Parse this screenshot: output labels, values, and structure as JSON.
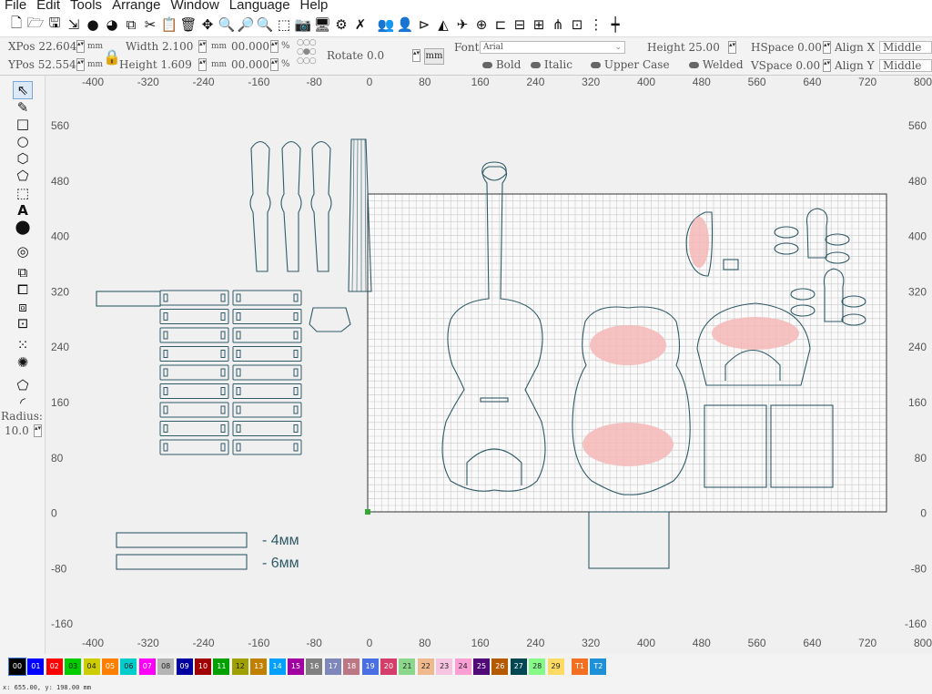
{
  "menu": [
    "File",
    "Edit",
    "Tools",
    "Arrange",
    "Window",
    "Language",
    "Help"
  ],
  "toolbar_icons": [
    "new-file-icon",
    "open-folder-icon",
    "save-icon",
    "export-icon",
    "undo-icon",
    "redo-icon",
    "copy-icon",
    "cut-icon",
    "paste-icon",
    "delete-icon",
    "move-icon",
    "zoom-in-icon",
    "zoom-out-icon",
    "zoom-fit-icon",
    "camera-icon",
    "monitor-icon",
    "settings-tools-icon",
    "users-icon",
    "user-icon",
    "align-icon",
    "mirror-icon",
    "send-icon",
    "target-icon",
    "arrange-icon",
    "distribute-icon",
    "group-icon",
    "ungroup-icon",
    "grid-icon"
  ],
  "props": {
    "xpos_label": "XPos",
    "xpos_value": "22.604",
    "ypos_label": "YPos",
    "ypos_value": "52.554",
    "unit": "mm",
    "width_label": "Width",
    "width_value": "2.100",
    "height_label": "Height",
    "height_value": "1.609",
    "scale_w": "00.000",
    "scale_h": "00.000",
    "percent": "%",
    "rotate_label": "Rotate",
    "rotate_value": "0.0",
    "mm_button": "mm"
  },
  "text_props": {
    "font_label": "Font",
    "font_value": "Arial",
    "height_label": "Height",
    "height_value": "25.00",
    "hspace_label": "HSpace",
    "hspace_value": "0.00",
    "vspace_label": "VSpace",
    "vspace_value": "0.00",
    "alignx_label": "Align X",
    "alignx_value": "Middle",
    "aligny_label": "Align Y",
    "aligny_value": "Middle",
    "bold_label": "Bold",
    "italic_label": "Italic",
    "upper_label": "Upper Case",
    "welded_label": "Welded"
  },
  "left_tools": {
    "radius_label": "Radius:",
    "radius_value": "10.0"
  },
  "ruler": {
    "x_ticks": [
      "-400",
      "-320",
      "-240",
      "-160",
      "-80",
      "0",
      "80",
      "160",
      "240",
      "320",
      "400",
      "480",
      "560",
      "640",
      "720",
      "800"
    ],
    "y_ticks": [
      "560",
      "480",
      "400",
      "320",
      "240",
      "160",
      "80",
      "0",
      "-80",
      "-160"
    ]
  },
  "annotations": {
    "label_4mm": "- 4мм",
    "label_6mm": "- 6мм"
  },
  "palette": [
    {
      "label": "00",
      "color": "#000000"
    },
    {
      "label": "01",
      "color": "#0000ff"
    },
    {
      "label": "02",
      "color": "#ff0000"
    },
    {
      "label": "03",
      "color": "#00cc00"
    },
    {
      "label": "04",
      "color": "#cccc00"
    },
    {
      "label": "05",
      "color": "#ff8000"
    },
    {
      "label": "06",
      "color": "#00cccc"
    },
    {
      "label": "07",
      "color": "#ff00ff"
    },
    {
      "label": "08",
      "color": "#b4b4b4"
    },
    {
      "label": "09",
      "color": "#0000a0"
    },
    {
      "label": "10",
      "color": "#a00000"
    },
    {
      "label": "11",
      "color": "#00a000"
    },
    {
      "label": "12",
      "color": "#a0a000"
    },
    {
      "label": "13",
      "color": "#c08000"
    },
    {
      "label": "14",
      "color": "#00a0ff"
    },
    {
      "label": "15",
      "color": "#a000a0"
    },
    {
      "label": "16",
      "color": "#808080"
    },
    {
      "label": "17",
      "color": "#7d87b9"
    },
    {
      "label": "18",
      "color": "#bb7784"
    },
    {
      "label": "19",
      "color": "#4a6fe3"
    },
    {
      "label": "20",
      "color": "#d33f6a"
    },
    {
      "label": "21",
      "color": "#8cd78c"
    },
    {
      "label": "22",
      "color": "#f0b98d"
    },
    {
      "label": "23",
      "color": "#f6c4e1"
    },
    {
      "label": "24",
      "color": "#fa9ed4"
    },
    {
      "label": "25",
      "color": "#500a78"
    },
    {
      "label": "26",
      "color": "#b45a00"
    },
    {
      "label": "27",
      "color": "#004754"
    },
    {
      "label": "28",
      "color": "#86fa88"
    },
    {
      "label": "29",
      "color": "#ffdb66"
    },
    {
      "label": "T1",
      "color": "#f37021"
    },
    {
      "label": "T2",
      "color": "#1e90d8"
    }
  ],
  "status": {
    "coords": "x: 655.00, y: 198.00 mm"
  }
}
